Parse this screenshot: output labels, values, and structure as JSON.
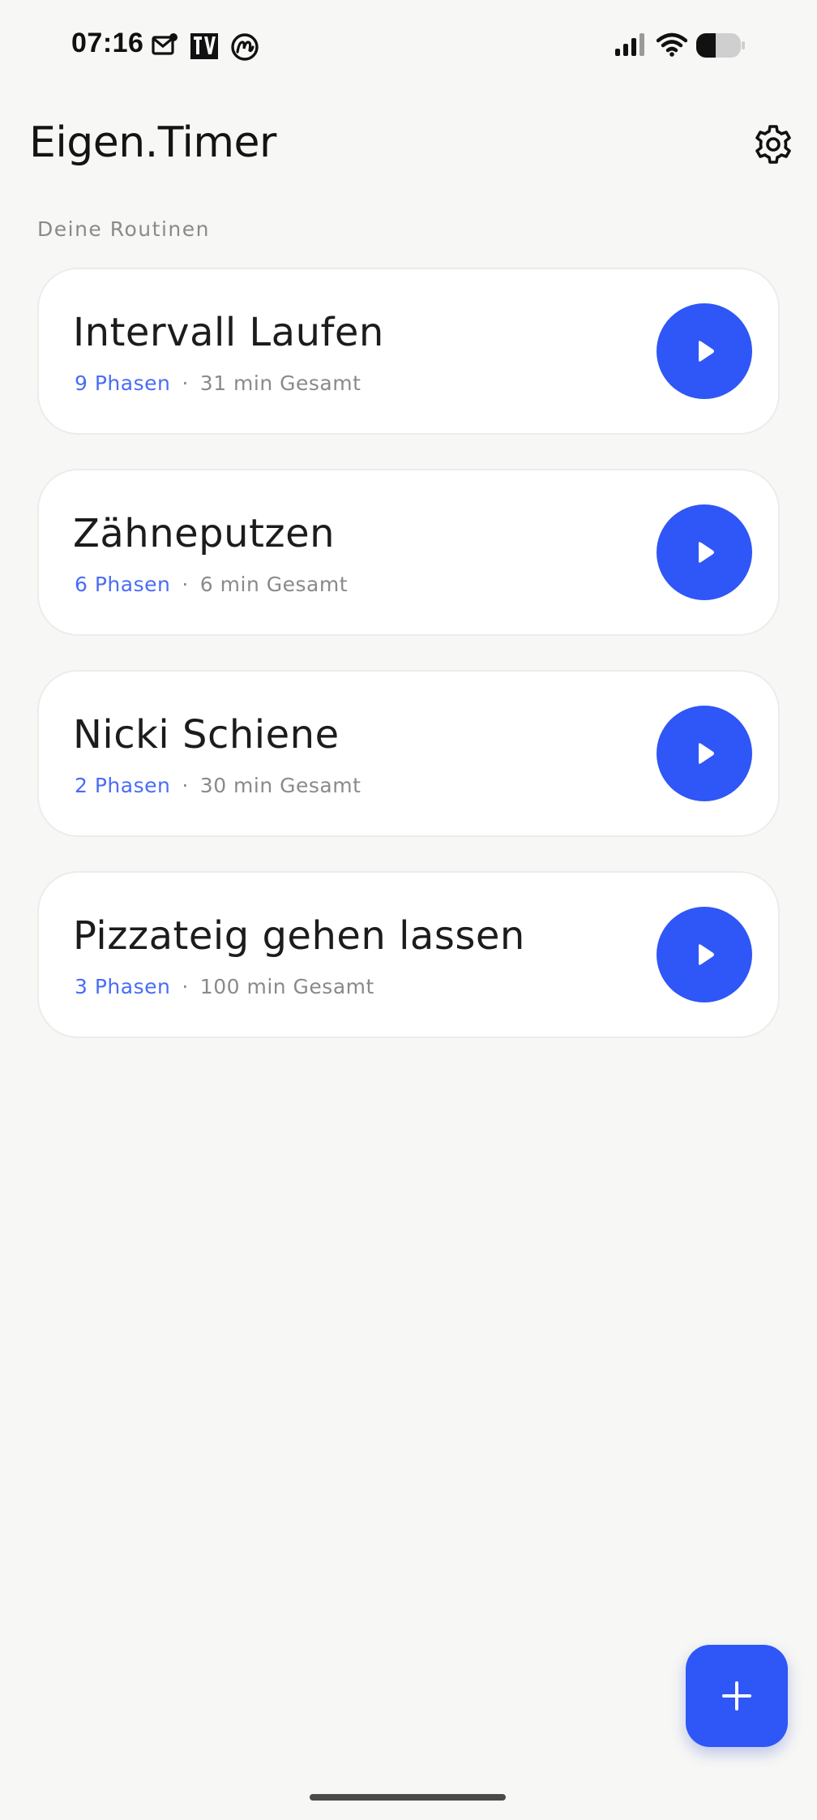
{
  "status_bar": {
    "time": "07:16",
    "left_icons": [
      "mail-icon",
      "tv-app-icon",
      "at-sign-icon"
    ],
    "right_icons": [
      "signal-icon",
      "wifi-icon",
      "battery-icon"
    ]
  },
  "header": {
    "title": "Eigen.Timer",
    "settings_icon": "gear-icon"
  },
  "section": {
    "label": "Deine Routinen"
  },
  "routines": [
    {
      "name": "Intervall Laufen",
      "phases": "9 Phasen",
      "separator": "·",
      "total": "31 min Gesamt",
      "action_icon": "play-icon"
    },
    {
      "name": "Zähneputzen",
      "phases": "6 Phasen",
      "separator": "·",
      "total": "6 min Gesamt",
      "action_icon": "play-icon"
    },
    {
      "name": "Nicki Schiene",
      "phases": "2 Phasen",
      "separator": "·",
      "total": "30 min Gesamt",
      "action_icon": "play-icon"
    },
    {
      "name": "Pizzateig gehen lassen",
      "phases": "3 Phasen",
      "separator": "·",
      "total": "100 min Gesamt",
      "action_icon": "play-icon"
    }
  ],
  "fab": {
    "icon": "plus-icon"
  },
  "colors": {
    "accent": "#2f56f6",
    "phases_text": "#4a6cf7",
    "muted_text": "#8a8a8a",
    "background": "#f7f7f5",
    "card": "#ffffff"
  }
}
